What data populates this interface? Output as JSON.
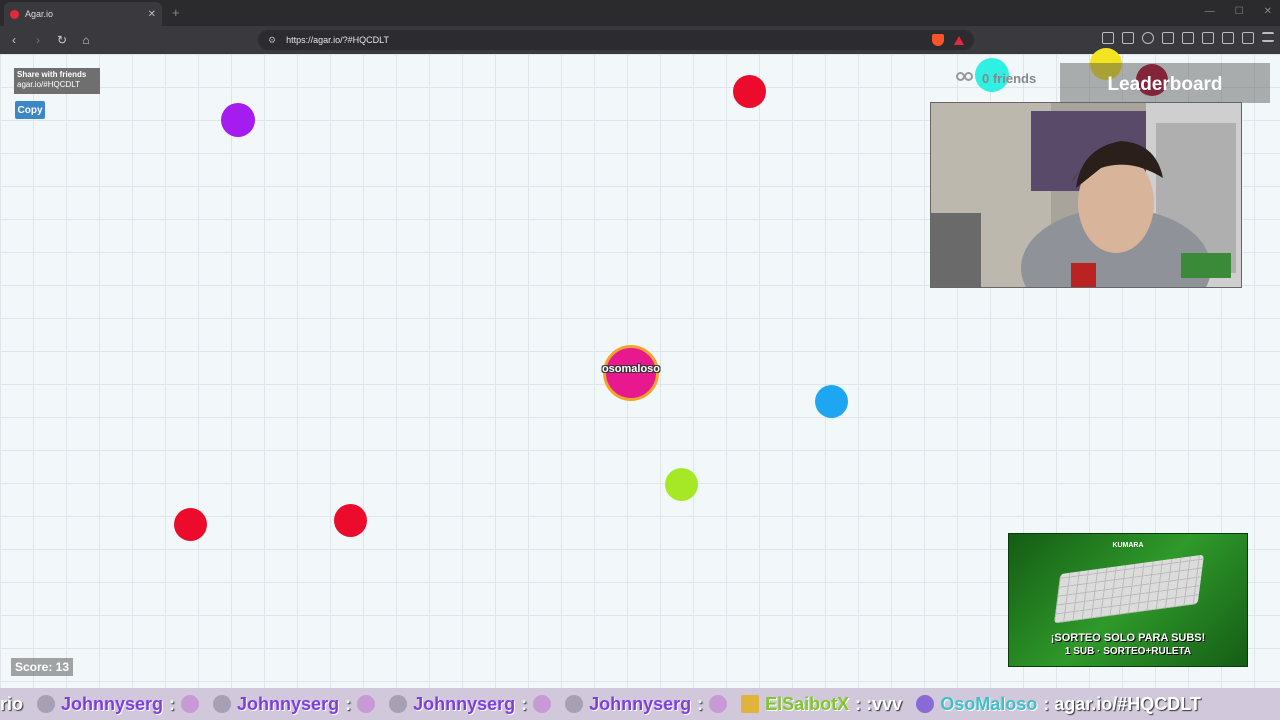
{
  "browser": {
    "tab_title": "Agar.io",
    "tab_close": "✕",
    "new_tab": "+",
    "url": "https://agar.io/?#HQCDLT",
    "window_controls": [
      "—",
      "☐",
      "✕"
    ]
  },
  "share": {
    "heading": "Share with friends",
    "link": "agar.io/#HQCDLT",
    "copy_label": "Copy"
  },
  "player": {
    "name": "osomaloso",
    "color": "#e8188f",
    "border_color": "#f0a52a"
  },
  "friends": {
    "label": "0 friends"
  },
  "leaderboard": {
    "title": "Leaderboard"
  },
  "score": {
    "label": "Score: 13"
  },
  "ad": {
    "brand": "KUMARA",
    "line1": "¡SORTEO SOLO PARA SUBS!",
    "line2": "1 SUB · SORTEO+RULETA"
  },
  "ticker": {
    "lead": "rio",
    "items": [
      {
        "user": "Johnnyserg",
        "sep": ":"
      },
      {
        "user": "Johnnyserg",
        "sep": ":"
      },
      {
        "user": "Johnnyserg",
        "sep": ":"
      },
      {
        "user": "Johnnyserg",
        "sep": ":"
      }
    ],
    "saibot_user": "ElSaibotX",
    "saibot_msg": ": :vvv",
    "oso_user": "OsoMaloso",
    "oso_msg": ": agar.io/#HQCDLT"
  },
  "pellet_colors": {
    "purple": "#a51cf0",
    "red": "#ec0b2a",
    "blue": "#1fa6f2",
    "lime": "#a6e825",
    "cyan": "#2ff0e3",
    "yellow": "#f4e321"
  }
}
